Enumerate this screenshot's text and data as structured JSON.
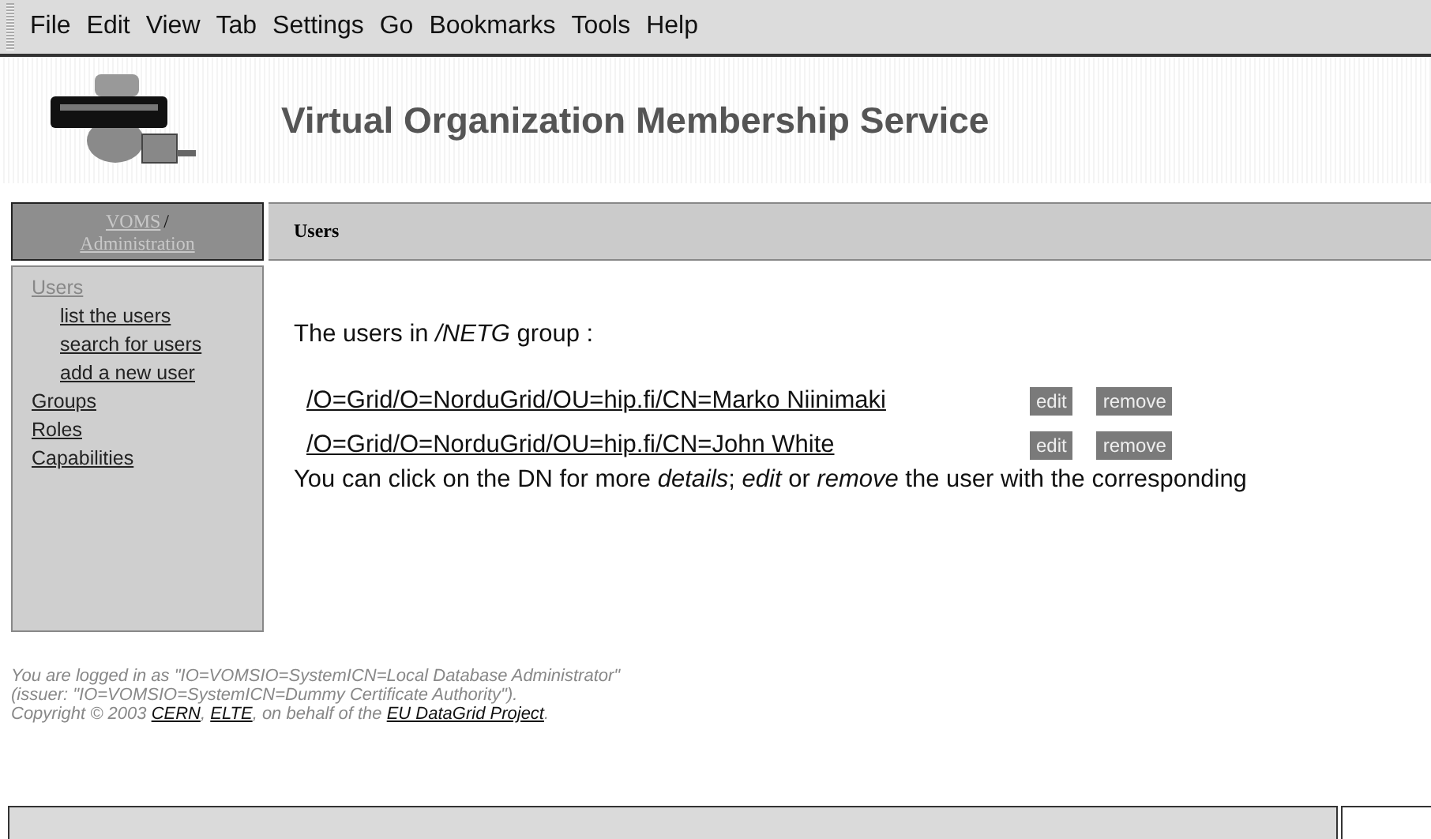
{
  "menu": [
    "File",
    "Edit",
    "View",
    "Tab",
    "Settings",
    "Go",
    "Bookmarks",
    "Tools",
    "Help"
  ],
  "header": {
    "title": "Virtual Organization Membership Service"
  },
  "breadcrumb": {
    "links": [
      "VOMS",
      "Administration"
    ],
    "separator": "/"
  },
  "sidebar": {
    "items": [
      {
        "label": "Users",
        "selected": true,
        "children": [
          {
            "label": "list the users",
            "selected": false
          },
          {
            "label": "search for users",
            "selected": false
          },
          {
            "label": "add a new user",
            "selected": false
          }
        ]
      },
      {
        "label": "Groups",
        "selected": false
      },
      {
        "label": "Roles",
        "selected": false
      },
      {
        "label": "Capabilities",
        "selected": false
      }
    ]
  },
  "content": {
    "section_title": "Users",
    "heading": "The users in */NETG* group :",
    "users": [
      {
        "dn": "/O=Grid/O=NorduGrid/OU=hip.fi/CN=Marko Niinimaki",
        "actions": [
          "edit",
          "remove"
        ]
      },
      {
        "dn": "/O=Grid/O=NorduGrid/OU=hip.fi/CN=John White",
        "actions": [
          "edit",
          "remove"
        ]
      }
    ],
    "note": "You can click on the DN for more *details*; *edit* or *remove* the user with the corresponding"
  },
  "footer": {
    "lines": [
      [
        {
          "text": "You are logged in as \"IO=VOMSIO=SystemICN=Local Database Administrator\"",
          "link": false
        }
      ],
      [
        {
          "text": "(issuer: \"IO=VOMSIO=SystemICN=Dummy Certificate Authority\").",
          "link": false
        }
      ],
      [
        {
          "text": "Copyright © 2003 ",
          "link": false
        },
        {
          "text": "CERN",
          "link": true
        },
        {
          "text": ", ",
          "link": false
        },
        {
          "text": "ELTE",
          "link": true
        },
        {
          "text": ", on behalf of the ",
          "link": false
        },
        {
          "text": "EU DataGrid Project",
          "link": true
        },
        {
          "text": ".",
          "link": false
        }
      ]
    ]
  }
}
